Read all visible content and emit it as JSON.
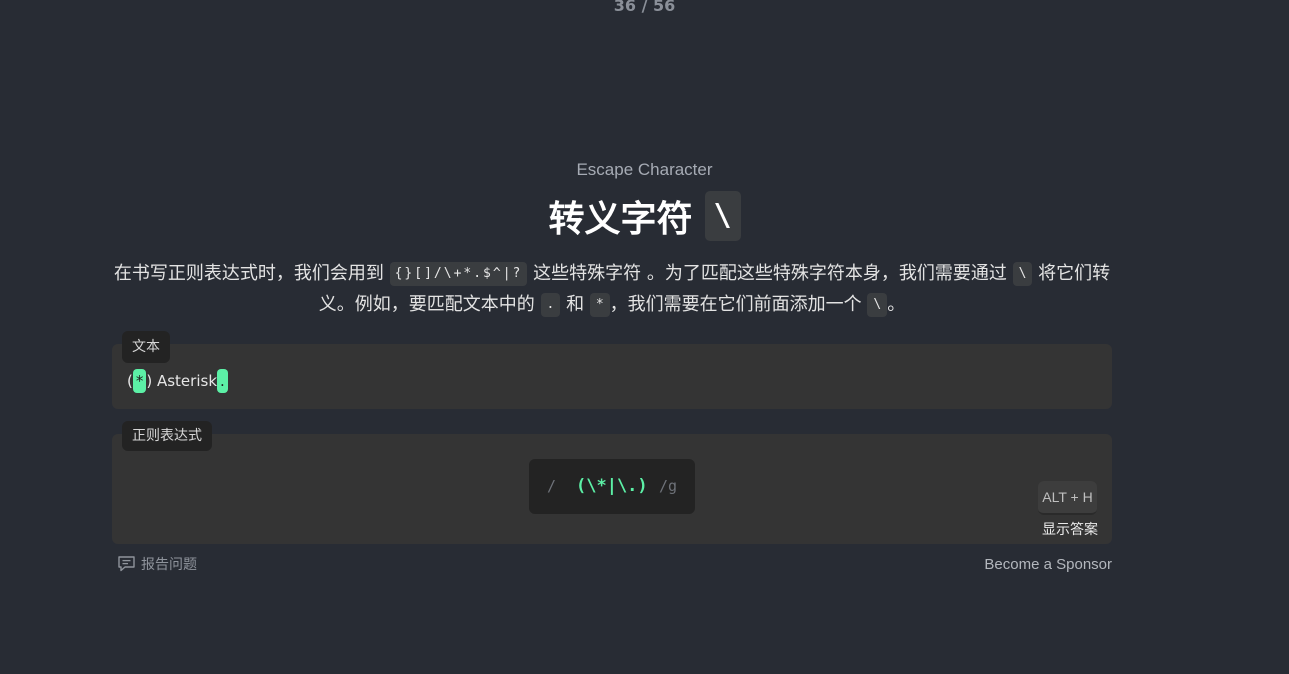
{
  "progress": "36 / 56",
  "lesson": {
    "subtitle": "Escape Character",
    "title": "转义字符",
    "title_code": "\\"
  },
  "description": {
    "part1": "在书写正则表达式时，我们会用到",
    "special_chars": "{}[]/\\+*.$^|?",
    "part2": "这些特殊字符 。为了匹配这些特殊字符本身，我们需要通过",
    "escape_char": "\\",
    "part3": "将它们转义。例如，要匹配文本中的",
    "dot_char": ".",
    "part4": "和",
    "star_char": "*",
    "part5": "，我们需要在它们前面添加一个",
    "escape_char_2": "\\",
    "part6": "。"
  },
  "text_panel": {
    "tag": "文本",
    "open_paren": "(",
    "match1": "*",
    "middle": ") Asterisk",
    "match2": "."
  },
  "regex_panel": {
    "tag": "正则表达式",
    "slash_open": "/",
    "value": "(\\*|\\.)",
    "flags": "/g",
    "shortcut": "ALT + H",
    "show_answer": "显示答案"
  },
  "footer": {
    "report": "报告问题",
    "sponsor": "Become a Sponsor"
  },
  "colors": {
    "background": "#282c34",
    "panel": "#343434",
    "match_highlight": "#5cf0a6",
    "regex_text": "#5cf0a6"
  },
  "icons": {
    "report": "comment-icon"
  }
}
